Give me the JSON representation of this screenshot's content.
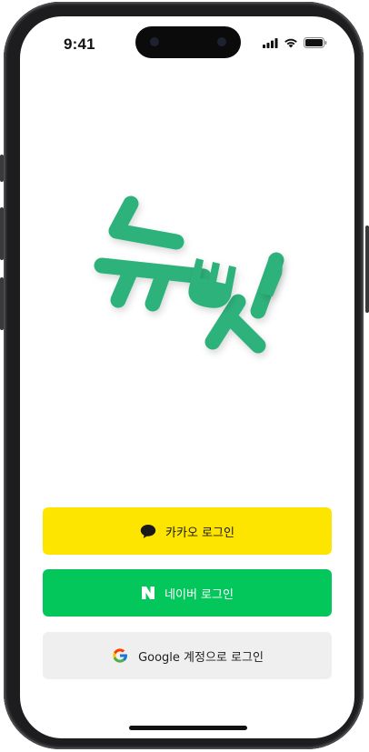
{
  "status_bar": {
    "time": "9:41",
    "icons": [
      "cellular-signal-icon",
      "wifi-icon",
      "battery-icon"
    ]
  },
  "logo": {
    "name": "nyu-bap-logo",
    "color": "#2EB27B"
  },
  "login_buttons": {
    "kakao": {
      "label": "카카오 로그인",
      "icon": "kakao-talk-bubble-icon",
      "color": "#FEE500"
    },
    "naver": {
      "label": "네이버 로그인",
      "icon": "naver-n-icon",
      "color": "#03C75A"
    },
    "google": {
      "label": "Google 계정으로 로그인",
      "icon": "google-g-icon",
      "color": "#EFEFEF"
    }
  }
}
